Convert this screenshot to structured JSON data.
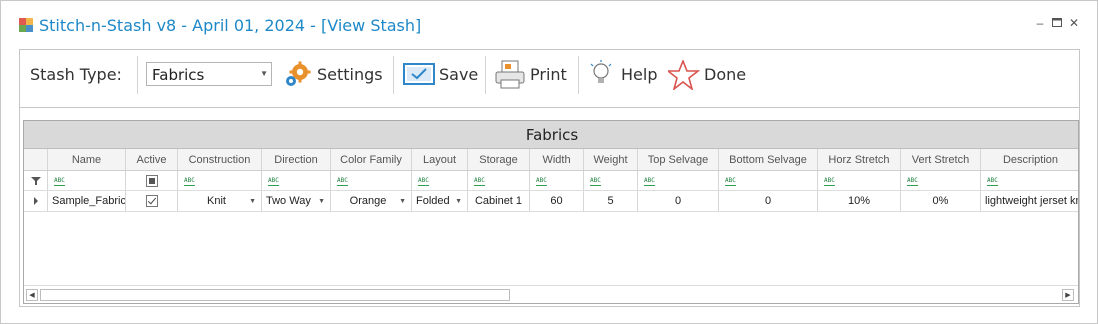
{
  "window": {
    "title": "Stitch-n-Stash v8 - April 01, 2024 - [View Stash]",
    "controls": [
      "minimize-icon",
      "maximize-icon",
      "close-icon"
    ]
  },
  "toolbar": {
    "stash_type_label": "Stash Type:",
    "stash_type_value": "Fabrics",
    "settings_label": "Settings",
    "save_label": "Save",
    "print_label": "Print",
    "help_label": "Help",
    "done_label": "Done",
    "icons": {
      "settings": "gears-icon",
      "save": "monitor-check-icon",
      "print": "printer-icon",
      "help": "lightbulb-icon",
      "done": "star-icon"
    },
    "colors": {
      "settings_gear": "#e8912d",
      "save_icon": "#2f86c9",
      "done_star": "#d9534f"
    }
  },
  "grid": {
    "group_title": "Fabrics",
    "columns": [
      "Name",
      "Active",
      "Construction",
      "Direction",
      "Color Family",
      "Layout",
      "Storage",
      "Width",
      "Weight",
      "Top Selvage",
      "Bottom Selvage",
      "Horz Stretch",
      "Vert Stretch",
      "Description"
    ],
    "filter_row_icon": "filter-icon",
    "filter_text_icon": "abc-filter-icon",
    "rows": [
      {
        "name": "Sample_Fabric",
        "active": true,
        "construction": "Knit",
        "direction": "Two Way",
        "color_family": "Orange",
        "layout": "Folded",
        "storage": "Cabinet 1",
        "width": "60",
        "weight": "5",
        "top_selvage": "0",
        "bottom_selvage": "0",
        "horz_stretch": "10%",
        "vert_stretch": "0%",
        "description": "lightweight jerset kn"
      }
    ]
  }
}
